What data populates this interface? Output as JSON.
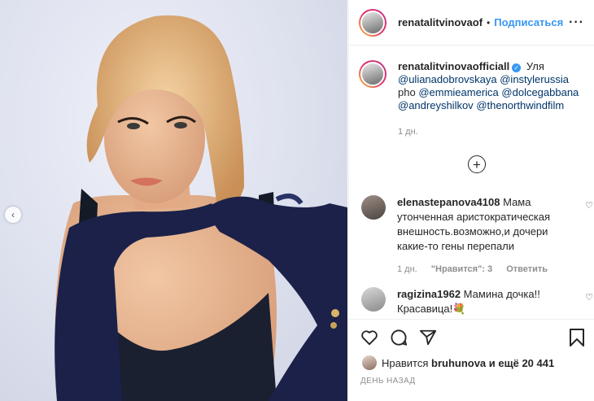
{
  "post": {
    "image_alt": "Portrait of a woman with blonde hair wearing long navy gloves",
    "prev_arrow": "‹"
  },
  "header": {
    "username": "renatalitvinovaof",
    "separator": "•",
    "follow_label": "Подписаться",
    "more_label": "···"
  },
  "caption": {
    "username": "renatalitvinovaofficiall",
    "verified_mark": "✓",
    "text_1": "Уля",
    "mention_1": "@ulianadobrovskaya",
    "mention_2": "@instylerussia",
    "text_2": "pho",
    "mention_3": "@emmieamerica",
    "mention_4": "@dolcegabbana",
    "mention_5": "@andreyshilkov",
    "mention_6": "@thenorthwindfilm",
    "time": "1 дн."
  },
  "load_more_label": "+",
  "comments": [
    {
      "username": "elenastepanova4108",
      "text": "Мама утонченная аристократическая внешность.возможно,и дочери какие-то гены перепали",
      "time": "1 дн.",
      "likes": "\"Нравится\": 3",
      "reply": "Ответить",
      "heart": "♡"
    },
    {
      "username": "ragizina1962",
      "text": "Мамина дочка!! Красавица!💐",
      "heart": "♡"
    }
  ],
  "actions": {
    "likes_prefix": "Нравится",
    "likes_user": "bruhunova",
    "likes_suffix": "и ещё 20 441",
    "date": "ДЕНЬ НАЗАД"
  },
  "colors": {
    "accent": "#3897f0",
    "glove": "#1b2149",
    "hair": "#e5b887"
  }
}
